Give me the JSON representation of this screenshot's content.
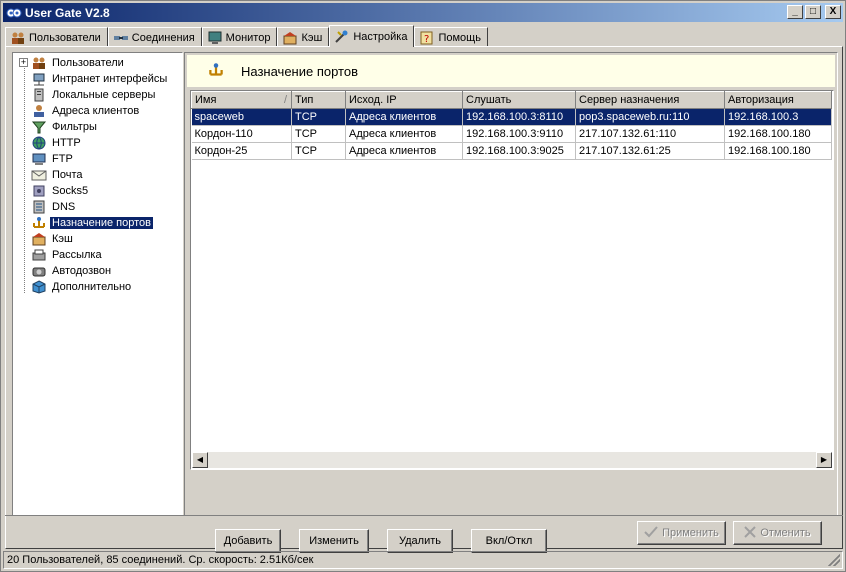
{
  "window": {
    "title": "User Gate V2.8",
    "minimize": "_",
    "maximize": "□",
    "close": "X"
  },
  "tabs": [
    {
      "label": "Пользователи",
      "icon": "users-icon"
    },
    {
      "label": "Соединения",
      "icon": "connections-icon"
    },
    {
      "label": "Монитор",
      "icon": "monitor-icon"
    },
    {
      "label": "Кэш",
      "icon": "cache-icon"
    },
    {
      "label": "Настройка",
      "icon": "settings-icon",
      "active": true
    },
    {
      "label": "Помощь",
      "icon": "help-icon"
    }
  ],
  "tree": {
    "items": [
      {
        "label": "Пользователи",
        "icon": "users-icon",
        "expander": "+"
      },
      {
        "label": "Интранет интерфейсы",
        "icon": "network-interfaces-icon"
      },
      {
        "label": "Локальные серверы",
        "icon": "server-icon"
      },
      {
        "label": "Адреса клиентов",
        "icon": "client-address-icon"
      },
      {
        "label": "Фильтры",
        "icon": "filter-icon"
      },
      {
        "label": "HTTP",
        "icon": "globe-icon"
      },
      {
        "label": "FTP",
        "icon": "ftp-icon"
      },
      {
        "label": "Почта",
        "icon": "mail-icon"
      },
      {
        "label": "Socks5",
        "icon": "socks-icon"
      },
      {
        "label": "DNS",
        "icon": "dns-icon"
      },
      {
        "label": "Назначение портов",
        "icon": "port-mapping-icon",
        "selected": true
      },
      {
        "label": "Кэш",
        "icon": "cache-icon"
      },
      {
        "label": "Рассылка",
        "icon": "broadcast-icon"
      },
      {
        "label": "Автодозвон",
        "icon": "autodial-icon"
      },
      {
        "label": "Дополнительно",
        "icon": "cube-icon"
      }
    ]
  },
  "panel": {
    "title": "Назначение портов",
    "table": {
      "columns": [
        "Имя",
        "Тип",
        "Исход. IP",
        "Слушать",
        "Сервер назначения",
        "Авторизация"
      ],
      "sort_indicator": "/",
      "rows": [
        [
          "spaceweb",
          "TCP",
          "Адреса клиентов",
          "192.168.100.3:8110",
          "pop3.spaceweb.ru:110",
          "192.168.100.3"
        ],
        [
          "Кордон-110",
          "TCP",
          "Адреса клиентов",
          "192.168.100.3:9110",
          "217.107.132.61:110",
          "192.168.100.180"
        ],
        [
          "Кордон-25",
          "TCP",
          "Адреса клиентов",
          "192.168.100.3:9025",
          "217.107.132.61:25",
          "192.168.100.180"
        ]
      ]
    },
    "buttons": {
      "add": "Добавить",
      "edit": "Изменить",
      "delete": "Удалить",
      "toggle": "Вкл/Откл"
    }
  },
  "footer": {
    "apply": "Применить",
    "cancel": "Отменить"
  },
  "status": {
    "text": "20 Пользователей, 85 соединений. Ср. скорость: 2.51Кб/сек"
  },
  "colors": {
    "selection": "#0a246a",
    "header_band": "#ffffe8",
    "face": "#d4d0c8"
  }
}
